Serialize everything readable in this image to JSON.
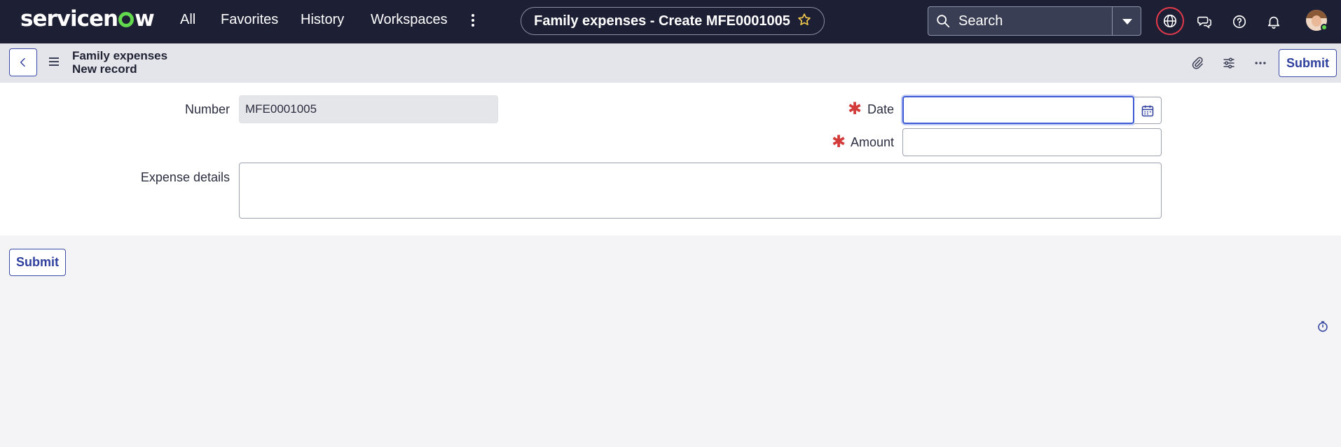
{
  "brand": {
    "logo_text_1": "service",
    "logo_text_2": "w",
    "logo_o": "no"
  },
  "nav": {
    "links": [
      "All",
      "Favorites",
      "History",
      "Workspaces"
    ],
    "current_page_title": "Family expenses - Create MFE0001005",
    "search_placeholder": "Search"
  },
  "form_header": {
    "table_name": "Family expenses",
    "record_state": "New record",
    "submit_label": "Submit"
  },
  "form": {
    "number_label": "Number",
    "number_value": "MFE0001005",
    "date_label": "Date",
    "date_value": "",
    "amount_label": "Amount",
    "amount_value": "",
    "details_label": "Expense details",
    "details_value": "",
    "required_marker": "✱"
  },
  "footer": {
    "submit_label": "Submit"
  },
  "colors": {
    "nav_bg": "#1d2035",
    "accent": "#2e3f9e",
    "required": "#d33a3a",
    "focus": "#3c5ad6",
    "presence": "#62d84e"
  },
  "icons": [
    "search-icon",
    "globe-icon",
    "chat-icon",
    "help-icon",
    "bell-icon",
    "star-icon",
    "back-icon",
    "menu-icon",
    "attachment-icon",
    "settings-sliders-icon",
    "more-icon",
    "calendar-icon",
    "timer-icon"
  ]
}
